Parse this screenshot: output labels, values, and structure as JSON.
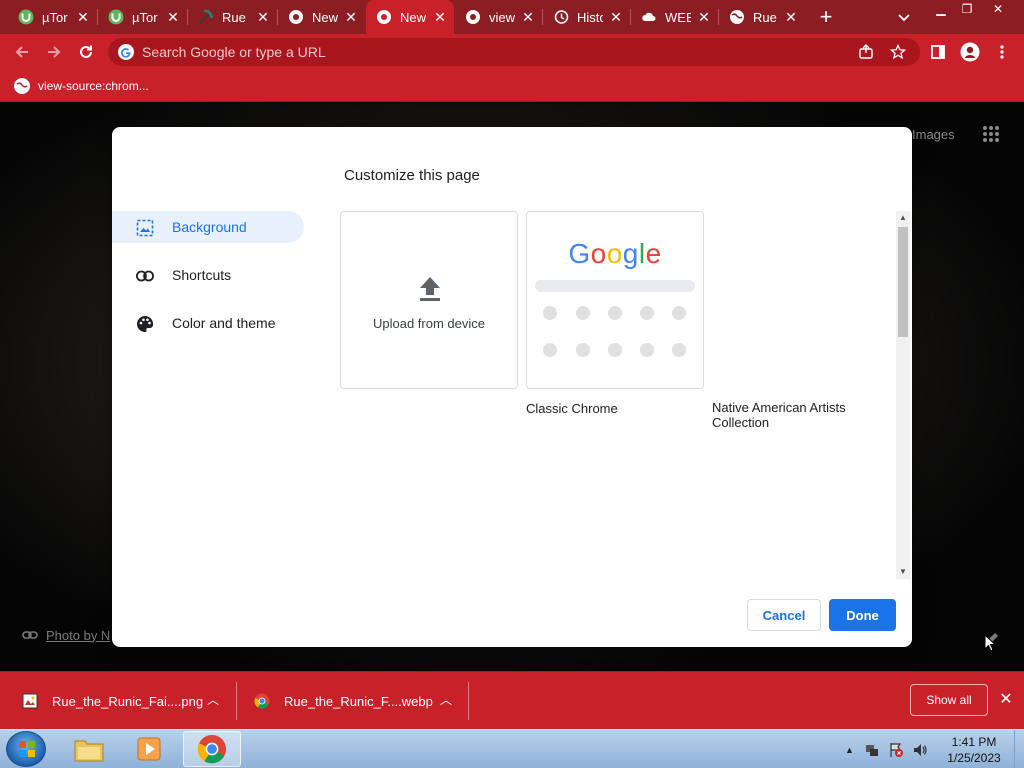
{
  "tabs": [
    {
      "title": "µTor",
      "icon": "utorrent-icon",
      "active": false
    },
    {
      "title": "µTor",
      "icon": "utorrent-icon",
      "active": false
    },
    {
      "title": "Rue",
      "icon": "pickaxe-icon",
      "active": false
    },
    {
      "title": "New",
      "icon": "chrome-icon",
      "active": false
    },
    {
      "title": "New",
      "icon": "chrome-icon",
      "active": true
    },
    {
      "title": "view",
      "icon": "chrome-icon",
      "active": false
    },
    {
      "title": "Histo",
      "icon": "history-icon",
      "active": false
    },
    {
      "title": "WEB",
      "icon": "cloud-icon",
      "active": false
    },
    {
      "title": "Rue",
      "icon": "globe-icon",
      "active": false
    }
  ],
  "toolbar": {
    "omnibox_placeholder": "Search Google or type a URL"
  },
  "bookmarks": [
    {
      "label": "view-source:chrom...",
      "icon": "globe-icon"
    }
  ],
  "ntp": {
    "images_link": "Images",
    "photo_credit": "Photo by N"
  },
  "dialog": {
    "title": "Customize this page",
    "nav": [
      {
        "label": "Background",
        "icon": "image-icon",
        "selected": true
      },
      {
        "label": "Shortcuts",
        "icon": "link-icon",
        "selected": false
      },
      {
        "label": "Color and theme",
        "icon": "palette-icon",
        "selected": false
      }
    ],
    "tiles": {
      "upload_label": "Upload from device",
      "classic_logo": "Google",
      "classic_caption": "Classic Chrome",
      "collection_caption": "Native American Artists Collection"
    },
    "cancel_label": "Cancel",
    "done_label": "Done"
  },
  "downloads": {
    "items": [
      {
        "name": "Rue_the_Runic_Fai....png",
        "icon": "image-file-icon"
      },
      {
        "name": "Rue_the_Runic_F....webp",
        "icon": "chrome-icon"
      }
    ],
    "show_all_label": "Show all"
  },
  "taskbar": {
    "time": "1:41 PM",
    "date": "1/25/2023",
    "apps": [
      "explorer-icon",
      "media-player-icon",
      "chrome-icon"
    ]
  },
  "colors": {
    "theme_red": "#c8212a",
    "tabstrip_red": "#8c1d23",
    "accent_blue": "#1a73e8"
  }
}
